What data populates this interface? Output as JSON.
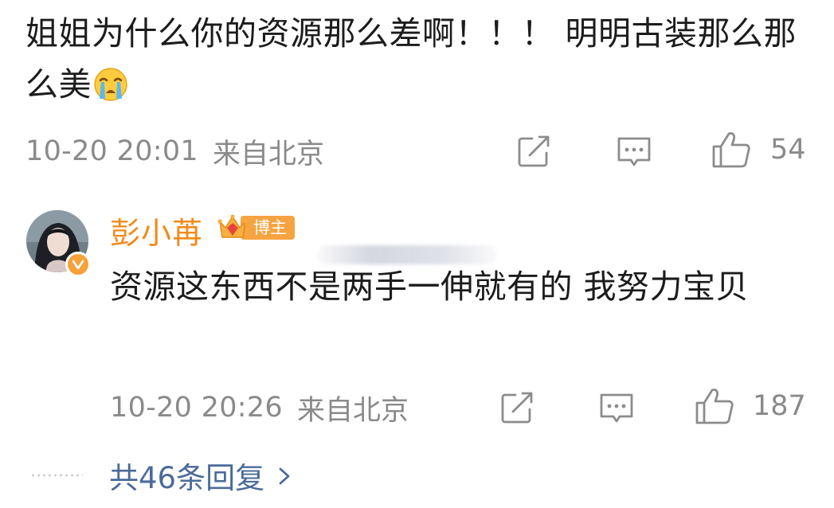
{
  "comment": {
    "text": "姐姐为什么你的资源那么差啊！！！ 明明古装那么那么美",
    "emoji": "loudly-crying-face-emoji",
    "time": "10-20 20:01",
    "location": "来自北京",
    "likes": "54"
  },
  "reply": {
    "author": "彭小苒",
    "badge_label": "博主",
    "text": "资源这东西不是两手一伸就有的 我努力宝贝",
    "time": "10-20 20:26",
    "location": "来自北京",
    "likes": "187"
  },
  "replies_link": {
    "label": "共46条回复"
  },
  "colors": {
    "author_name": "#f28a1a",
    "badge": "#f6a341",
    "link": "#4a6b9a",
    "meta": "#8a8a8a"
  }
}
